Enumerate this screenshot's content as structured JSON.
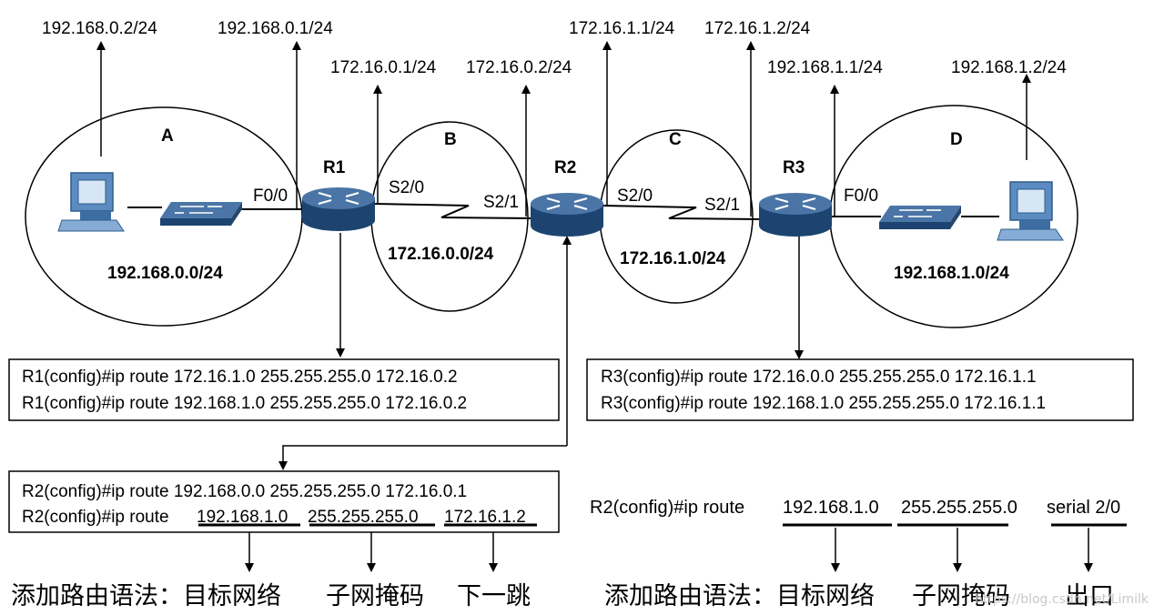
{
  "networks": {
    "A": {
      "name": "A",
      "subnet": "192.168.0.0/24"
    },
    "B": {
      "name": "B",
      "subnet": "172.16.0.0/24"
    },
    "C": {
      "name": "C",
      "subnet": "172.16.1.0/24"
    },
    "D": {
      "name": "D",
      "subnet": "192.168.1.0/24"
    }
  },
  "routers": {
    "r1": "R1",
    "r2": "R2",
    "r3": "R3"
  },
  "ports": {
    "r1_f0": "F0/0",
    "r1_s20": "S2/0",
    "r2_s21": "S2/1",
    "r2_s20": "S2/0",
    "r3_s21": "S2/1",
    "r3_f0": "F0/0"
  },
  "addresses": {
    "pc_a": "192.168.0.2/24",
    "r1_f0": "192.168.0.1/24",
    "r1_s20": "172.16.0.1/24",
    "r2_s21": "172.16.0.2/24",
    "r2_s20": "172.16.1.1/24",
    "r3_s21": "172.16.1.2/24",
    "r3_f0": "192.168.1.1/24",
    "pc_d": "192.168.1.2/24"
  },
  "configs": {
    "r1": [
      "R1(config)#ip route 172.16.1.0 255.255.255.0 172.16.0.2",
      "R1(config)#ip route 192.168.1.0 255.255.255.0 172.16.0.2"
    ],
    "r3": [
      "R3(config)#ip route 172.16.0.0 255.255.255.0 172.16.1.1",
      "R3(config)#ip route 192.168.1.0 255.255.255.0 172.16.1.1"
    ],
    "r2_line1": "R2(config)#ip route 192.168.0.0 255.255.255.0 172.16.0.1",
    "r2_line2": {
      "prefix": "R2(config)#ip route ",
      "network": "192.168.1.0",
      "mask": "255.255.255.0",
      "nexthop": "172.16.1.2"
    },
    "r2_alt": {
      "prefix": "R2(config)#ip route ",
      "network": "192.168.1.0",
      "mask": "255.255.255.0",
      "exit": "serial 2/0"
    }
  },
  "syntax_left": {
    "title": "添加路由语法：目标网络",
    "mask": "子网掩码",
    "nexthop": "下一跳"
  },
  "syntax_right": {
    "title": "添加路由语法：目标网络",
    "mask": "子网掩码",
    "exit": "出口"
  },
  "watermark": "https://blog.csdn.net/Limilk",
  "colors": {
    "line": "#000000",
    "router_top": "#4a75a6",
    "router_body": "#1d4470",
    "switch": "#27476b",
    "pc": "#5b8bc1"
  }
}
